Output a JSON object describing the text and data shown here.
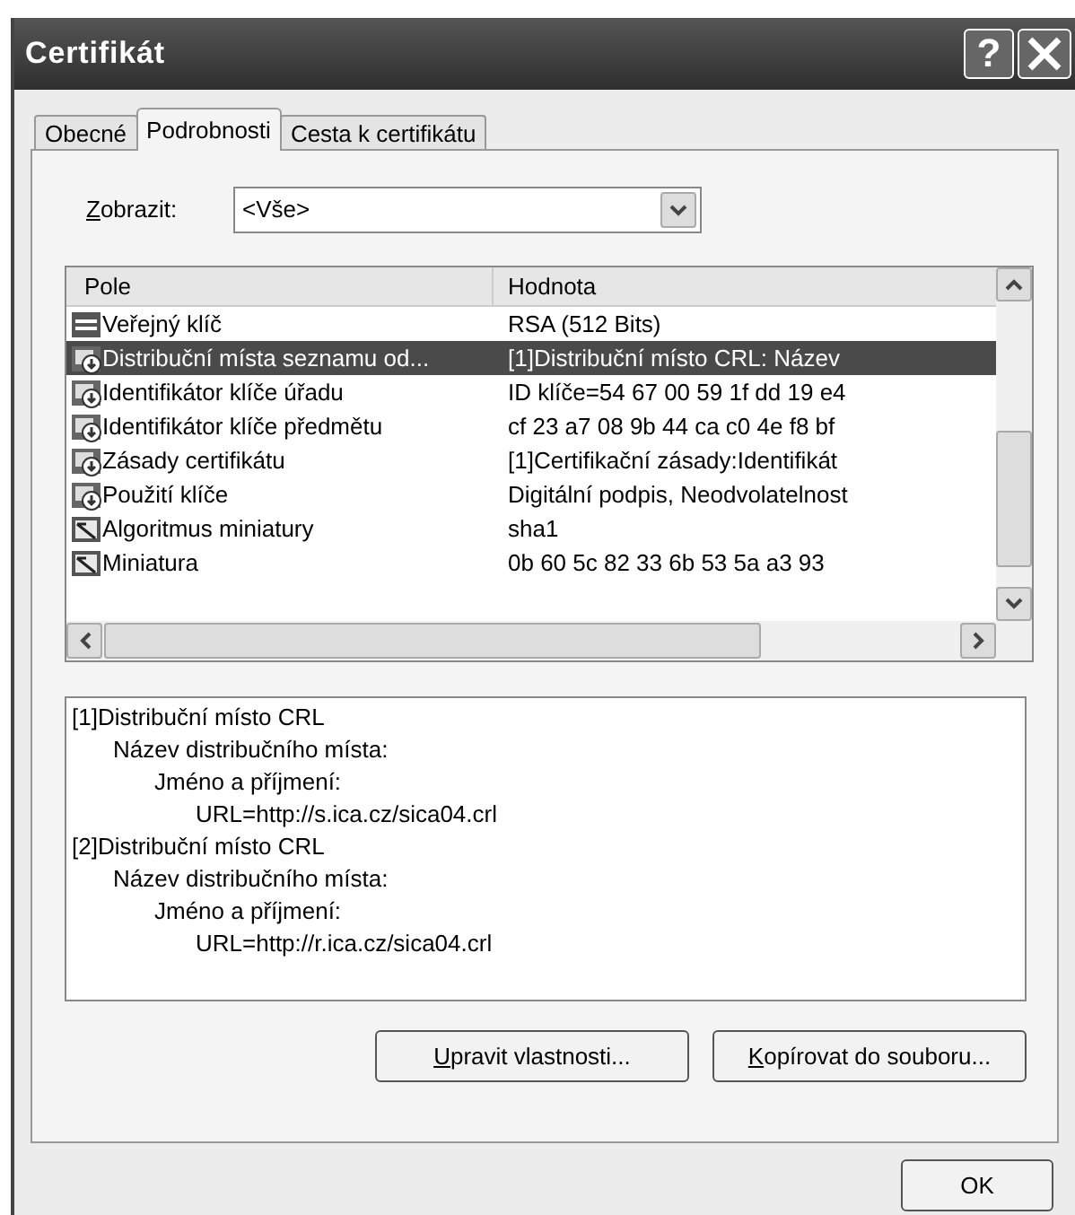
{
  "window": {
    "title": "Certifikát",
    "help_button": "?"
  },
  "tabs": [
    {
      "label": "Obecné",
      "selected": false
    },
    {
      "label": "Podrobnosti",
      "selected": true
    },
    {
      "label": "Cesta k certifikátu",
      "selected": false
    }
  ],
  "show_filter": {
    "label": "Zobrazit:",
    "value": "<Vše>"
  },
  "table": {
    "columns": [
      "Pole",
      "Hodnota"
    ],
    "rows": [
      {
        "kind": "key",
        "field": "Veřejný klíč",
        "value": "RSA (512 Bits)",
        "selected": false
      },
      {
        "kind": "extension",
        "field": "Distribuční místa seznamu od...",
        "value": "[1]Distribuční místo CRL: Název",
        "selected": true
      },
      {
        "kind": "extension",
        "field": "Identifikátor klíče úřadu",
        "value": "ID klíče=54 67 00 59 1f dd 19 e4",
        "selected": false
      },
      {
        "kind": "extension",
        "field": "Identifikátor klíče předmětu",
        "value": "cf 23 a7 08 9b 44 ca c0 4e f8 bf",
        "selected": false
      },
      {
        "kind": "extension",
        "field": "Zásady certifikátu",
        "value": "[1]Certifikační zásady:Identifikát",
        "selected": false
      },
      {
        "kind": "extension",
        "field": "Použití klíče",
        "value": "Digitální podpis, Neodvolatelnost",
        "selected": false
      },
      {
        "kind": "property",
        "field": "Algoritmus miniatury",
        "value": "sha1",
        "selected": false
      },
      {
        "kind": "property",
        "field": "Miniatura",
        "value": "0b 60 5c 82 33 6b 53 5a a3 93",
        "selected": false
      }
    ]
  },
  "details": [
    {
      "text": "[1]Distribuční místo CRL",
      "children": [
        {
          "text": "Název distribučního místa:",
          "children": [
            {
              "text": "Jméno a příjmení:",
              "children": [
                {
                  "text": "URL=http://s.ica.cz/sica04.crl"
                }
              ]
            }
          ]
        }
      ]
    },
    {
      "text": "[2]Distribuční místo CRL",
      "children": [
        {
          "text": "Název distribučního místa:",
          "children": [
            {
              "text": "Jméno a příjmení:",
              "children": [
                {
                  "text": "URL=http://r.ica.cz/sica04.crl"
                }
              ]
            }
          ]
        }
      ]
    }
  ],
  "buttons": [
    "Upravit vlastnosti...",
    "Kopírovat do souboru..."
  ],
  "footer_buttons": [
    "OK"
  ]
}
